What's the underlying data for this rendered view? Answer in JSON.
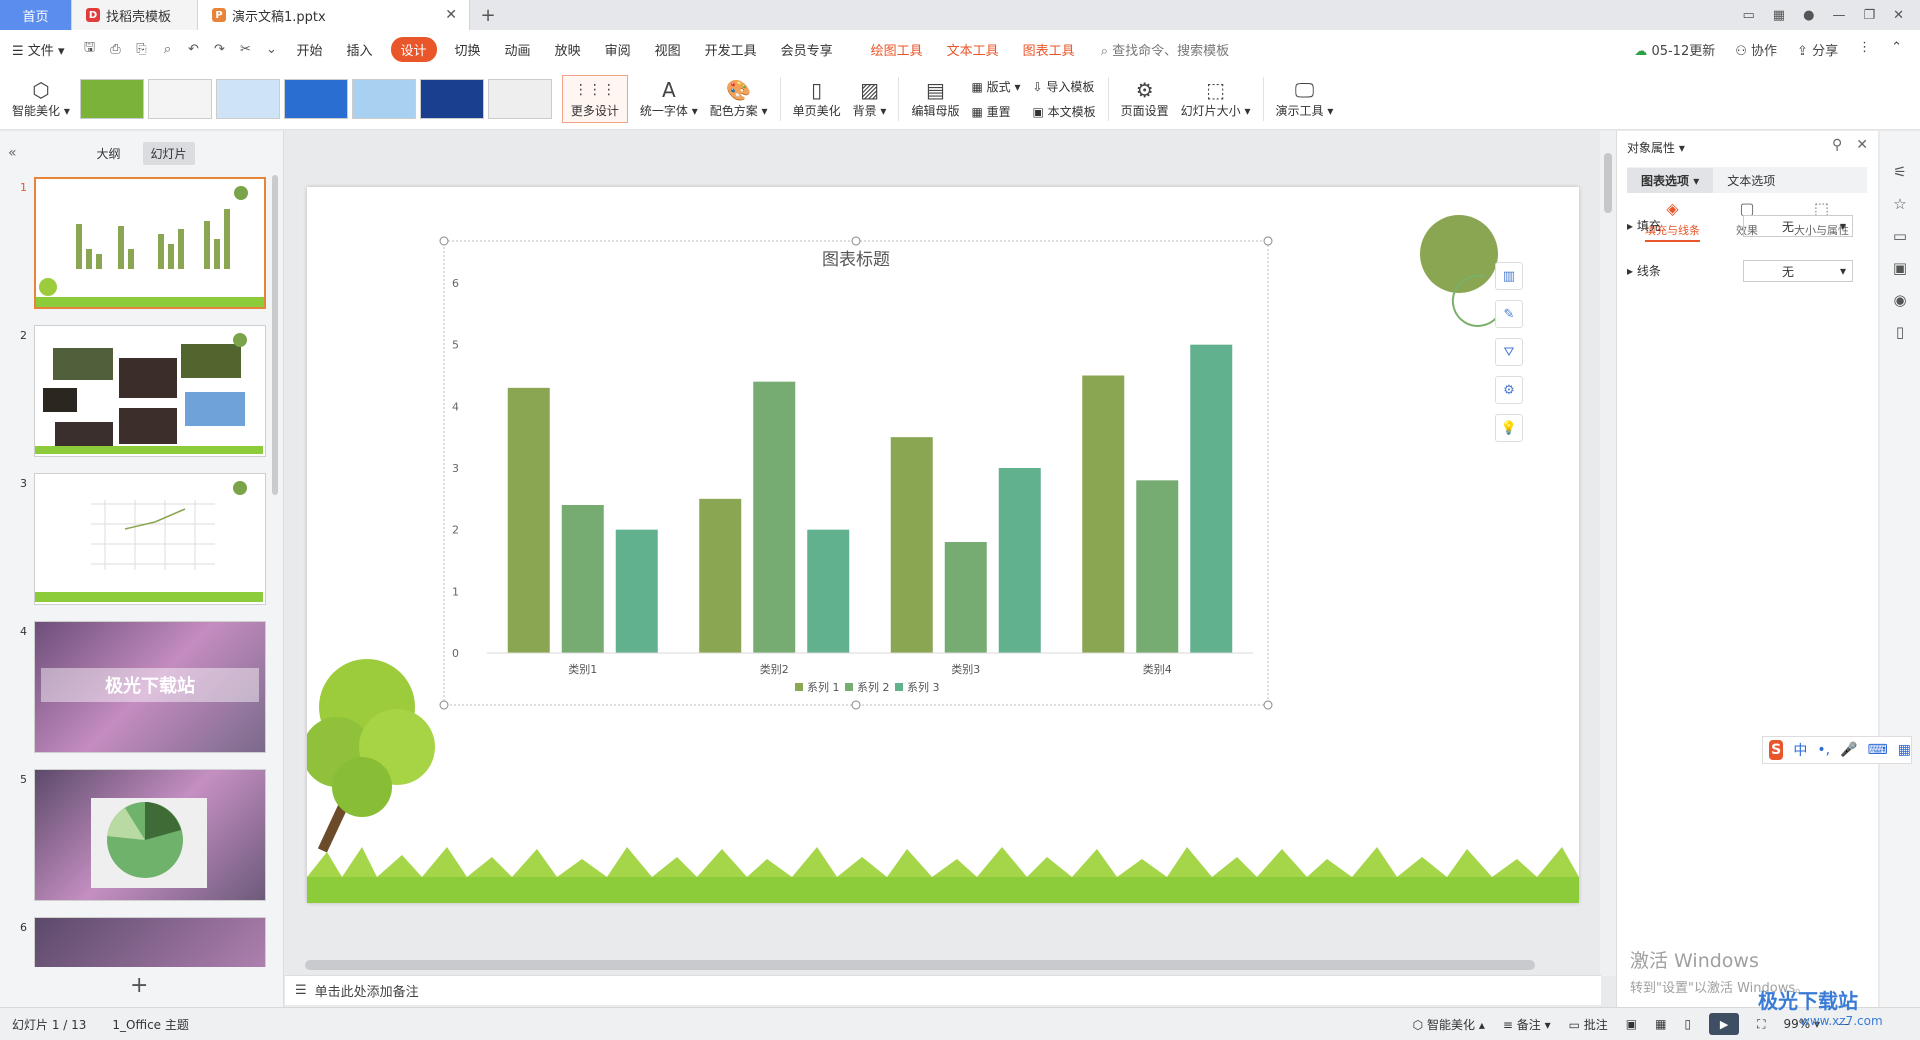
{
  "tabs": {
    "home": "首页",
    "template": "找稻壳模板",
    "document": "演示文稿1.pptx"
  },
  "menu": {
    "file": "文件",
    "items": [
      "开始",
      "插入",
      "设计",
      "切换",
      "动画",
      "放映",
      "审阅",
      "视图",
      "开发工具",
      "会员专享"
    ],
    "context_items": [
      "绘图工具",
      "文本工具",
      "图表工具"
    ],
    "search": "查找命令、搜索模板",
    "update": "05-12更新",
    "collab": "协作",
    "share": "分享"
  },
  "ribbon": {
    "smart": "智能美化",
    "more_design": "更多设计",
    "unify_font": "统一字体",
    "color_scheme": "配色方案",
    "single_page": "单页美化",
    "background": "背景",
    "edit_master": "编辑母版",
    "layout": "版式",
    "reset": "重置",
    "import_template": "导入模板",
    "this_template": "本文模板",
    "page_setup": "页面设置",
    "slide_size": "幻灯片大小",
    "present_tools": "演示工具"
  },
  "left_panel": {
    "tab_outline": "大纲",
    "tab_slides": "幻灯片",
    "slide_numbers": [
      "1",
      "2",
      "3",
      "4",
      "5",
      "6"
    ],
    "slide4_text": "极光下载站"
  },
  "chart_data": {
    "type": "bar",
    "title": "图表标题",
    "categories": [
      "类别1",
      "类别2",
      "类别3",
      "类别4"
    ],
    "series": [
      {
        "name": "系列 1",
        "values": [
          4.3,
          2.5,
          3.5,
          4.5
        ],
        "color": "#8aa653"
      },
      {
        "name": "系列 2",
        "values": [
          2.4,
          4.4,
          1.8,
          2.8
        ],
        "color": "#76ab72"
      },
      {
        "name": "系列 3",
        "values": [
          2,
          2,
          3,
          5
        ],
        "color": "#62b18e"
      }
    ],
    "yticks": [
      "0",
      "1",
      "2",
      "3",
      "4",
      "5",
      "6"
    ],
    "ylim": [
      0,
      6
    ],
    "legend": "bottom",
    "grid": false
  },
  "notes": "单击此处添加备注",
  "right_panel": {
    "title": "对象属性",
    "tab_chart": "图表选项",
    "tab_text": "文本选项",
    "sub_fill": "填充与线条",
    "sub_effect": "效果",
    "sub_size": "大小与属性",
    "fill_label": "填充",
    "fill_value": "无",
    "line_label": "线条",
    "line_value": "无"
  },
  "activate": {
    "line1": "激活 Windows",
    "line2": "转到\"设置\"以激活 Windows。"
  },
  "ime": "中",
  "status": {
    "slide_pos": "幻灯片 1 / 13",
    "theme": "1_Office 主题",
    "smart": "智能美化",
    "notes": "备注",
    "comment": "批注",
    "zoom": "99%"
  },
  "watermark": {
    "line1": "极光下载站",
    "line2": "www.xz7.com"
  },
  "colors": {
    "accent": "#e8562a",
    "home_tab": "#5b8def"
  }
}
